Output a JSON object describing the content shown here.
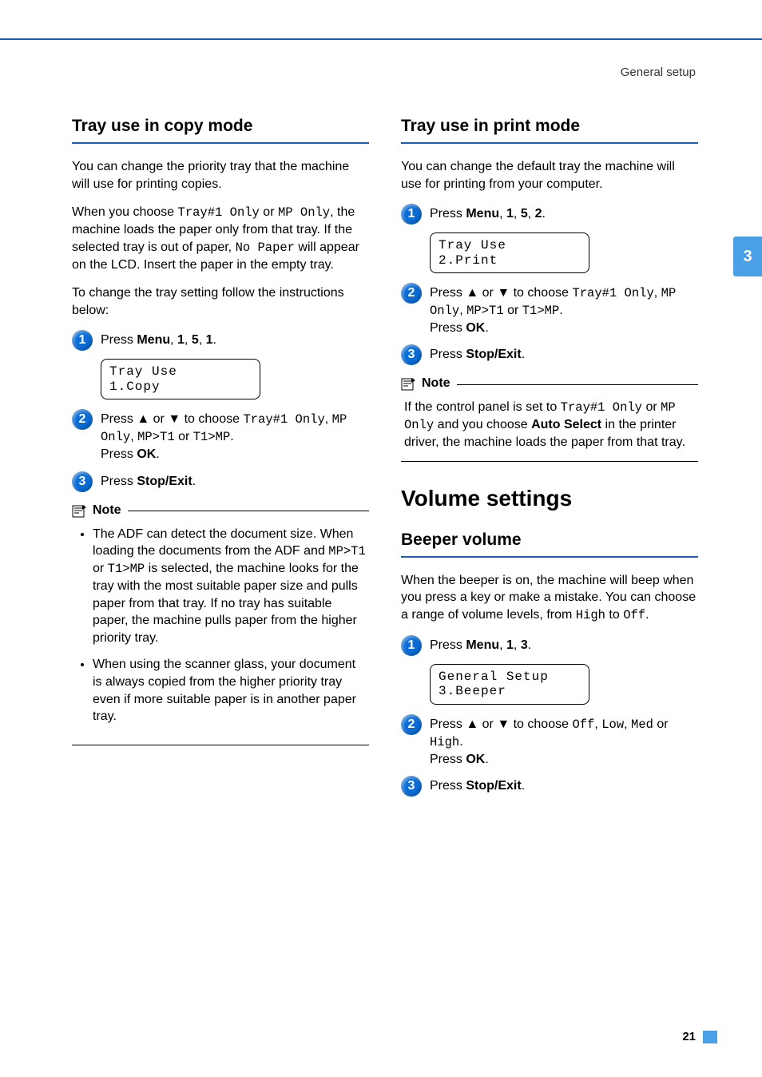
{
  "header": {
    "breadcrumb": "General setup"
  },
  "sideTab": "3",
  "pageNumber": "21",
  "left": {
    "h2": "Tray use in copy mode",
    "p1_a": "You can change the priority tray that the machine will use for printing copies.",
    "p2_a": "When you choose ",
    "p2_code1": "Tray#1 Only",
    "p2_b": " or ",
    "p2_code2": "MP Only",
    "p2_c": ", the machine loads the paper only from that tray. If the selected tray is out of paper, ",
    "p2_code3": "No Paper",
    "p2_d": " will appear on the LCD. Insert the paper in the empty tray.",
    "p3": "To change the tray setting follow the instructions below:",
    "step1_a": "Press ",
    "step1_b": "Menu",
    "step1_c": ", ",
    "step1_d": "1",
    "step1_e": ", ",
    "step1_f": "5",
    "step1_g": ", ",
    "step1_h": "1",
    "step1_i": ".",
    "lcd1_l1": "Tray Use",
    "lcd1_l2": "1.Copy",
    "step2_a": "Press ",
    "step2_up": "▲",
    "step2_b": " or ",
    "step2_dn": "▼",
    "step2_c": " to choose ",
    "step2_code1": "Tray#1 Only",
    "step2_d": ", ",
    "step2_code2": "MP Only",
    "step2_e": ", ",
    "step2_code3": "MP>T1",
    "step2_f": " or ",
    "step2_code4": "T1>MP",
    "step2_g": ".",
    "step2_h": "Press ",
    "step2_i": "OK",
    "step2_j": ".",
    "step3_a": "Press ",
    "step3_b": "Stop/Exit",
    "step3_c": ".",
    "noteLabel": "Note",
    "note_li1_a": "The ADF can detect the document size. When loading the documents from the ADF and ",
    "note_li1_code1": "MP>T1",
    "note_li1_b": " or ",
    "note_li1_code2": "T1>MP",
    "note_li1_c": " is selected, the machine looks for the tray with the most suitable paper size and pulls paper from that tray. If no tray has suitable paper, the machine pulls paper from the higher priority tray.",
    "note_li2": "When using the scanner glass, your document is always copied from the higher priority tray even if more suitable paper is in another paper tray."
  },
  "right": {
    "h2a": "Tray use in print mode",
    "p1": "You can change the default tray the machine will use for printing from your computer.",
    "a_step1_a": "Press ",
    "a_step1_b": "Menu",
    "a_step1_c": ", ",
    "a_step1_d": "1",
    "a_step1_e": ", ",
    "a_step1_f": "5",
    "a_step1_g": ", ",
    "a_step1_h": "2",
    "a_step1_i": ".",
    "a_lcd_l1": "Tray Use",
    "a_lcd_l2": "2.Print",
    "a_step2_a": "Press ",
    "a_step2_up": "▲",
    "a_step2_b": " or ",
    "a_step2_dn": "▼",
    "a_step2_c": " to choose ",
    "a_step2_code1": "Tray#1 Only",
    "a_step2_d": ", ",
    "a_step2_code2": "MP Only",
    "a_step2_e": ", ",
    "a_step2_code3": "MP>T1",
    "a_step2_f": " or ",
    "a_step2_code4": "T1>MP",
    "a_step2_g": ".",
    "a_step2_h": "Press ",
    "a_step2_i": "OK",
    "a_step2_j": ".",
    "a_step3_a": "Press ",
    "a_step3_b": "Stop/Exit",
    "a_step3_c": ".",
    "a_noteLabel": "Note",
    "a_note_a": "If the control panel is set to ",
    "a_note_code1": "Tray#1 Only",
    "a_note_b": " or ",
    "a_note_code2": "MP Only",
    "a_note_c": " and you choose ",
    "a_note_bold": "Auto Select",
    "a_note_d": " in the printer driver, the machine loads the paper from that tray.",
    "h1": "Volume settings",
    "h2b": "Beeper volume",
    "b_p1_a": "When the beeper is on, the machine will beep when you press a key or make a mistake. You can choose a range of volume levels, from ",
    "b_p1_code1": "High",
    "b_p1_b": " to ",
    "b_p1_code2": "Off",
    "b_p1_c": ".",
    "b_step1_a": "Press ",
    "b_step1_b": "Menu",
    "b_step1_c": ", ",
    "b_step1_d": "1",
    "b_step1_e": ", ",
    "b_step1_f": "3",
    "b_step1_g": ".",
    "b_lcd_l1": "General Setup",
    "b_lcd_l2": "3.Beeper",
    "b_step2_a": "Press ",
    "b_step2_up": "▲",
    "b_step2_b": " or ",
    "b_step2_dn": "▼",
    "b_step2_c": " to choose ",
    "b_step2_code1": "Off",
    "b_step2_d": ", ",
    "b_step2_code2": "Low",
    "b_step2_e": ", ",
    "b_step2_code3": "Med",
    "b_step2_f": " or ",
    "b_step2_code4": "High",
    "b_step2_g": ".",
    "b_step2_h": "Press ",
    "b_step2_i": "OK",
    "b_step2_j": ".",
    "b_step3_a": "Press ",
    "b_step3_b": "Stop/Exit",
    "b_step3_c": "."
  }
}
